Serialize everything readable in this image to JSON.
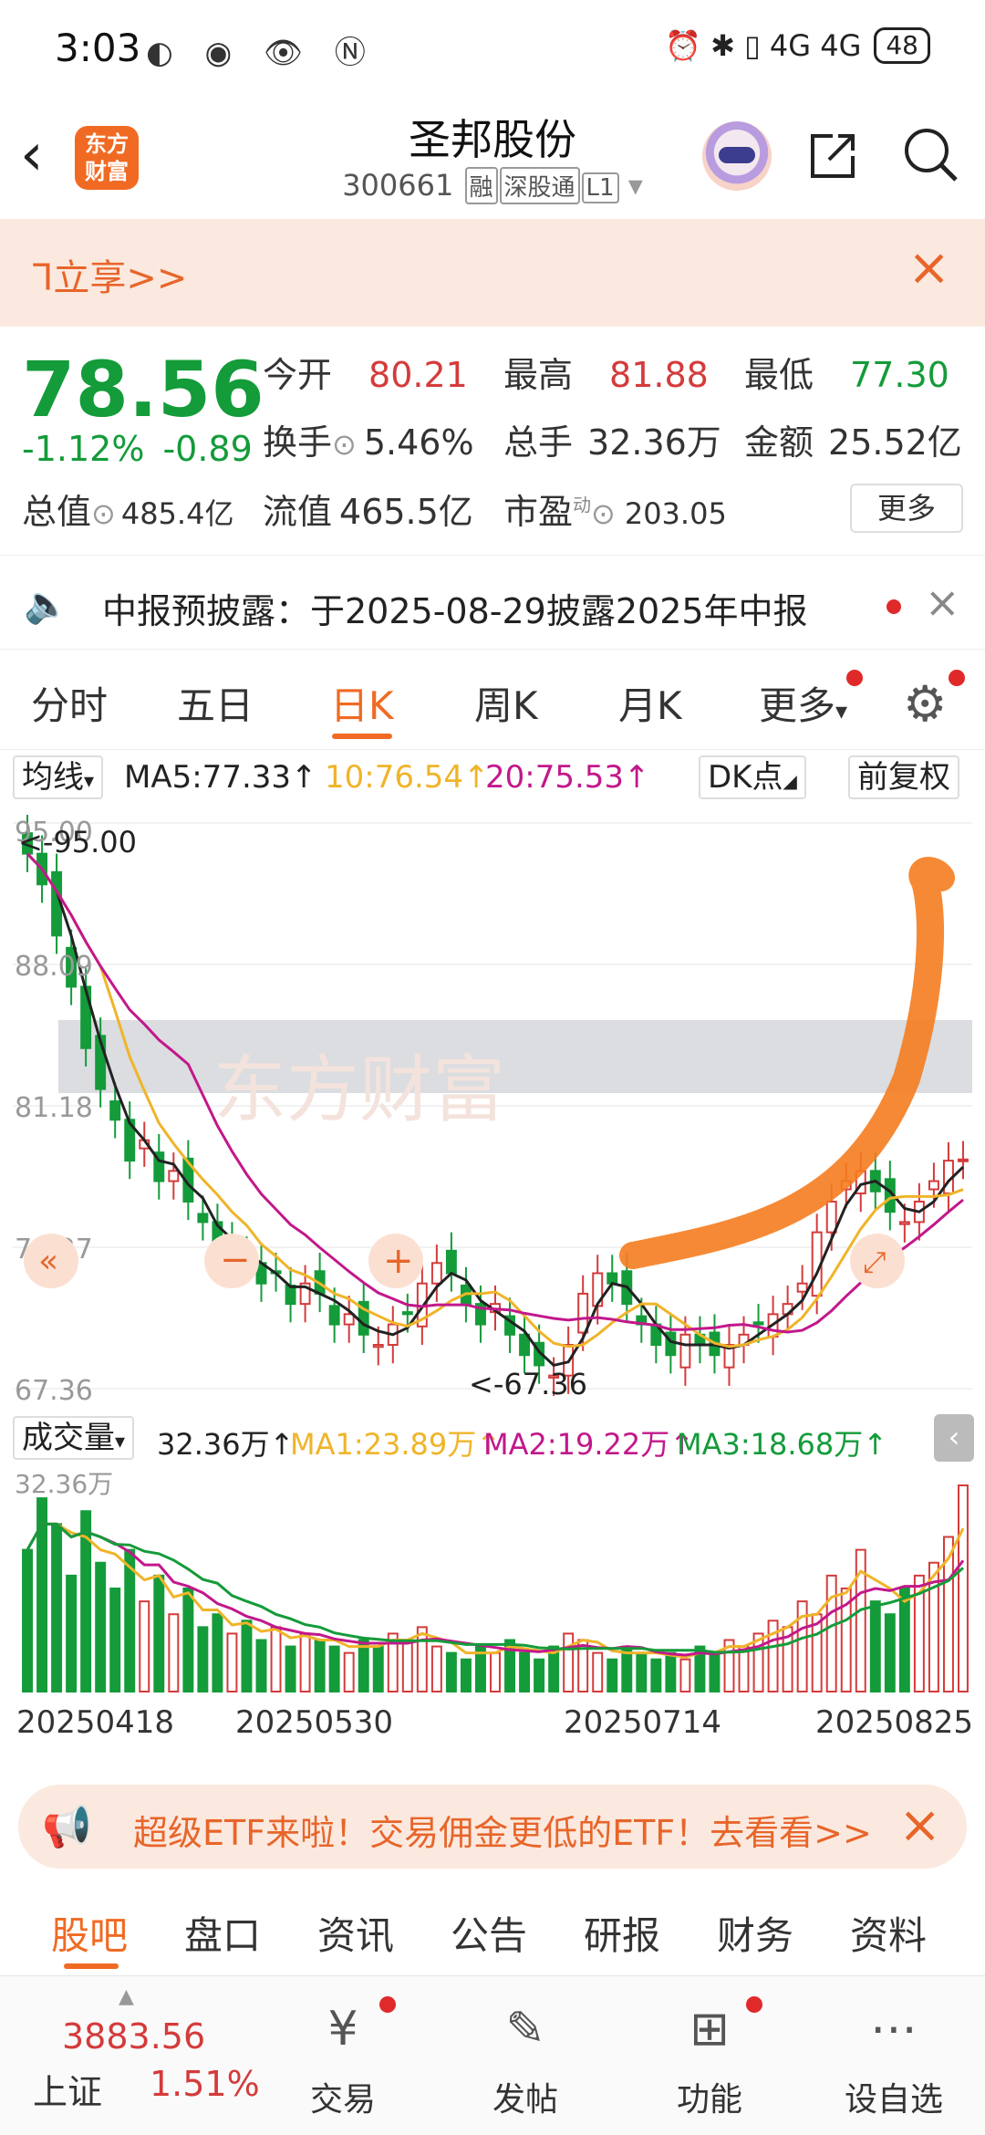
{
  "status": {
    "time": "3:03",
    "battery": "48",
    "left_icons": "◐ ◉ 👁 Ⓝ",
    "right_icons": "⏰ ✱ ▯ 4G 4G"
  },
  "header": {
    "title": "圣邦股份",
    "code": "300661",
    "tags": [
      "融",
      "深股通",
      "L1"
    ],
    "logo_text": "东方\n财富"
  },
  "promo": {
    "text": "ᒣ立享>>"
  },
  "quote": {
    "price": "78.56",
    "change_pct": "-1.12%",
    "change": "-0.89",
    "open_label": "今开",
    "open": "80.21",
    "high_label": "最高",
    "high": "81.88",
    "low_label": "最低",
    "low": "77.30",
    "turnover_label": "换手",
    "turnover": "5.46%",
    "volume_label": "总手",
    "volume": "32.36万",
    "amount_label": "金额",
    "amount": "25.52亿",
    "mcap_label": "总值",
    "mcap": "485.4亿",
    "float_label": "流值",
    "float": "465.5亿",
    "pe_label": "市盈",
    "pe_sup": "动",
    "pe": "203.05",
    "more": "更多"
  },
  "notice": {
    "text": "中报预披露：于2025-08-29披露2025年中报"
  },
  "tabs": [
    "分时",
    "五日",
    "日K",
    "周K",
    "月K",
    "更多"
  ],
  "ma": {
    "selector": "均线",
    "ma5": "MA5:77.33↑",
    "ma10": "10:76.54↑",
    "ma20": "20:75.53↑",
    "dk": "DK点",
    "adjust": "前复权",
    "colors": {
      "ma5": "#222222",
      "ma10": "#f0b429",
      "ma20": "#c2188b"
    }
  },
  "chart_data": {
    "type": "candlestick",
    "price_ticks": [
      "95.00",
      "88.09",
      "81.18",
      "74.27",
      "67.36"
    ],
    "high_marker": "<-95.00",
    "low_marker": "<-67.36",
    "ylim": [
      67.36,
      95.0
    ],
    "closes": [
      93.5,
      92.0,
      89.5,
      87.0,
      84.0,
      82.0,
      80.5,
      78.5,
      79.5,
      77.5,
      78.0,
      76.5,
      75.5,
      74.0,
      74.5,
      73.5,
      72.5,
      73.0,
      71.5,
      72.5,
      72.0,
      70.5,
      71.0,
      70.0,
      69.5,
      70.5,
      71.0,
      72.5,
      73.5,
      73.0,
      71.5,
      70.5,
      71.5,
      70.0,
      69.0,
      68.5,
      68.0,
      69.5,
      72.0,
      73.0,
      72.5,
      71.5,
      70.5,
      69.5,
      69.0,
      70.0,
      69.5,
      69.0,
      69.5,
      70.0,
      70.5,
      71.0,
      71.5,
      72.5,
      75.0,
      76.5,
      77.5,
      78.0,
      77.0,
      76.0,
      75.5,
      76.5,
      77.5,
      78.5,
      78.56
    ],
    "volume_label": "成交量",
    "volume_stats": {
      "total": "32.36万↑",
      "ma1": "MA1:23.89万↑",
      "ma2": "MA2:19.22万↑",
      "ma3": "MA3:18.68万↑"
    },
    "volume_tick": "32.36万",
    "volumes": [
      22,
      30,
      26,
      18,
      28,
      20,
      16,
      22,
      14,
      18,
      12,
      16,
      10,
      12,
      9,
      11,
      8,
      10,
      7,
      9,
      8,
      7,
      6,
      8,
      7,
      9,
      8,
      10,
      7,
      6,
      5,
      7,
      6,
      8,
      6,
      5,
      7,
      9,
      8,
      6,
      5,
      7,
      6,
      5,
      6,
      5,
      7,
      6,
      8,
      7,
      9,
      11,
      10,
      14,
      12,
      18,
      16,
      22,
      14,
      12,
      16,
      18,
      20,
      24,
      32
    ],
    "dates": [
      "20250418",
      "20250530",
      "20250714",
      "20250825"
    ]
  },
  "ad": {
    "text": "超级ETF来啦！交易佣金更低的ETF！去看看>>"
  },
  "subnav": [
    "股吧",
    "盘口",
    "资讯",
    "公告",
    "研报",
    "财务",
    "资料"
  ],
  "bottom": {
    "index_value": "3883.56",
    "index_name": "上证",
    "index_pct": "1.51%",
    "items": [
      "交易",
      "发帖",
      "功能",
      "设自选"
    ]
  }
}
